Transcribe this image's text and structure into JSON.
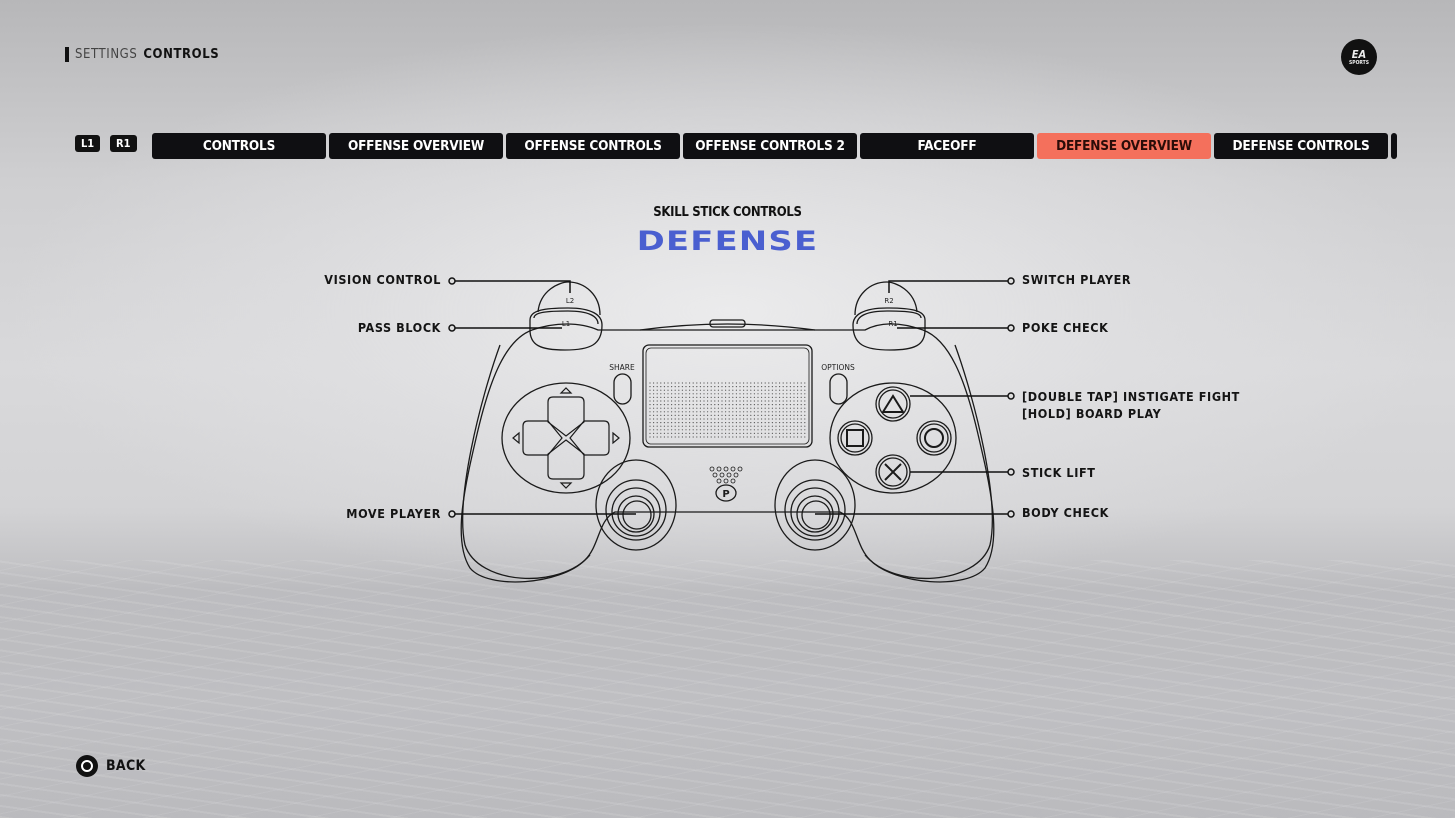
{
  "breadcrumb": {
    "parent": "SETTINGS",
    "current": "CONTROLS"
  },
  "logo": {
    "line1": "EA",
    "line2": "SPORTS"
  },
  "bumpers": {
    "left": "L1",
    "right": "R1"
  },
  "tabs": [
    {
      "label": "CONTROLS",
      "active": false
    },
    {
      "label": "OFFENSE OVERVIEW",
      "active": false
    },
    {
      "label": "OFFENSE CONTROLS",
      "active": false
    },
    {
      "label": "OFFENSE CONTROLS 2",
      "active": false
    },
    {
      "label": "FACEOFF",
      "active": false
    },
    {
      "label": "DEFENSE OVERVIEW",
      "active": true
    },
    {
      "label": "DEFENSE CONTROLS",
      "active": false
    }
  ],
  "colors": {
    "active_tab": "#f4705c",
    "heading_accent": "#4a5fd0",
    "tab_bg": "#0f0f12"
  },
  "page": {
    "subtitle": "SKILL STICK CONTROLS",
    "title": "DEFENSE"
  },
  "controller": {
    "button_labels": {
      "l2": "L2",
      "l1": "L1",
      "r2": "R2",
      "r1": "R1",
      "share": "SHARE",
      "options": "OPTIONS"
    }
  },
  "mappings": {
    "vision_control": "VISION CONTROL",
    "pass_block": "PASS BLOCK",
    "move_player": "MOVE PLAYER",
    "switch_player": "SWITCH PLAYER",
    "poke_check": "POKE CHECK",
    "triangle_line1": "[DOUBLE TAP] INSTIGATE FIGHT",
    "triangle_line2": "[HOLD] BOARD PLAY",
    "stick_lift": "STICK LIFT",
    "body_check": "BODY CHECK"
  },
  "footer": {
    "back_label": "BACK"
  }
}
